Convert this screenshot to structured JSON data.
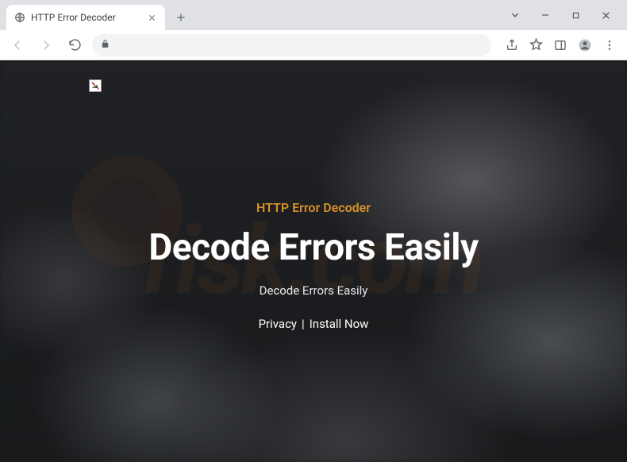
{
  "browser": {
    "tab_title": "HTTP Error Decoder",
    "url": ""
  },
  "page": {
    "eyebrow": "HTTP Error Decoder",
    "headline": "Decode Errors Easily",
    "subhead": "Decode Errors Easily",
    "links": {
      "privacy": "Privacy",
      "separator": "|",
      "install": "Install Now"
    }
  },
  "watermark": "risk.com"
}
